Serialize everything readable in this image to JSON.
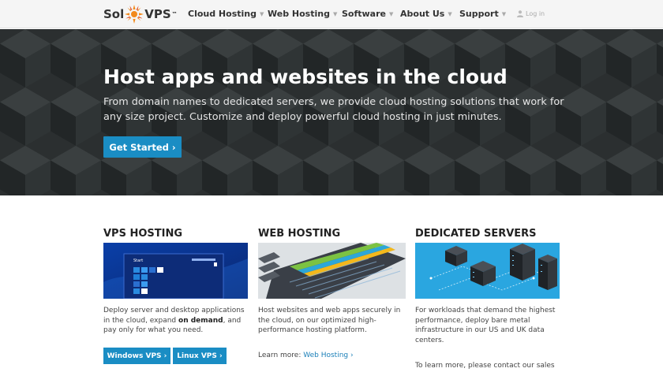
{
  "brand": {
    "name_left": "Sol",
    "name_right": "VPS",
    "trademark": "™"
  },
  "nav": {
    "items": [
      {
        "label": "Cloud Hosting"
      },
      {
        "label": "Web Hosting"
      },
      {
        "label": "Software"
      },
      {
        "label": "About Us"
      },
      {
        "label": "Support"
      }
    ],
    "login_label": "Log in"
  },
  "hero": {
    "title": "Host apps and websites in the cloud",
    "subtitle": "From domain names to dedicated servers, we provide cloud hosting solutions that work for any size project. Customize and deploy powerful cloud hosting in just minutes.",
    "cta_label": "Get Started ›"
  },
  "columns": {
    "vps": {
      "title": "VPS HOSTING",
      "desc_start": "Deploy server and desktop applications in the cloud, expand ",
      "desc_bold": "on demand",
      "desc_end": ", and pay only for what you need.",
      "windows_button": "Windows VPS ›",
      "linux_button": "Linux VPS ›",
      "screen_start_label": "Start"
    },
    "web": {
      "title": "WEB HOSTING",
      "desc": "Host websites and web apps securely in the cloud, on our optimized high-performance hosting platform.",
      "learn_prefix": "Learn more: ",
      "learn_link": "Web Hosting ›"
    },
    "dedicated": {
      "title": "DEDICATED SERVERS",
      "desc": "For workloads that demand the highest performance, deploy bare metal infrastructure in our US and UK data centers.",
      "contact": "To learn more, please contact our sales"
    }
  },
  "colors": {
    "accent": "#1a8dc4",
    "hero_bg": "#2b2f30",
    "logo_orange": "#f28a1c"
  }
}
